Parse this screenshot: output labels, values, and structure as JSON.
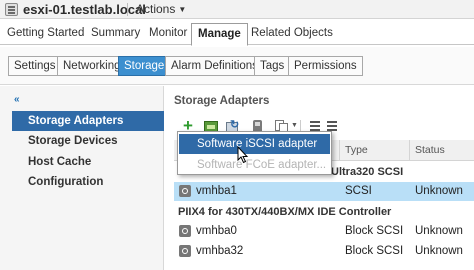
{
  "header": {
    "host_title": "esxi-01.testlab.local",
    "actions_label": "Actions",
    "host_icon": "host-server-icon",
    "actions_caret_icon": "chevron-down-icon"
  },
  "tabs": [
    {
      "label": "Getting Started"
    },
    {
      "label": "Summary"
    },
    {
      "label": "Monitor"
    },
    {
      "label": "Manage"
    },
    {
      "label": "Related Objects"
    }
  ],
  "subtabs": [
    {
      "label": "Settings"
    },
    {
      "label": "Networking"
    },
    {
      "label": "Storage"
    },
    {
      "label": "Alarm Definitions"
    },
    {
      "label": "Tags"
    },
    {
      "label": "Permissions"
    }
  ],
  "leftnav": {
    "collapse_glyph": "«",
    "items": [
      {
        "label": "Storage Adapters"
      },
      {
        "label": "Storage Devices"
      },
      {
        "label": "Host Cache Configuration"
      }
    ]
  },
  "main": {
    "section_title": "Storage Adapters",
    "toolbar_icons": [
      "add-icon",
      "adapter-chip-icon",
      "rescan-storage-icon",
      "device-icon",
      "copy-icon",
      "chevron-down-icon",
      "list-view-icon",
      "list-detail-icon"
    ],
    "columns": {
      "adapter": "",
      "type": "Type",
      "status": "Status"
    },
    "groups": [
      {
        "label_partial": "Ultra320 SCSI",
        "rows": [
          {
            "adapter": "vmhba1",
            "type": "SCSI",
            "status": "Unknown"
          }
        ]
      },
      {
        "label": "PIIX4 for 430TX/440BX/MX IDE Controller",
        "rows": [
          {
            "adapter": "vmhba0",
            "type": "Block SCSI",
            "status": "Unknown"
          },
          {
            "adapter": "vmhba32",
            "type": "Block SCSI",
            "status": "Unknown"
          }
        ]
      }
    ]
  },
  "add_menu": {
    "items": [
      {
        "label": "Software iSCSI adapter"
      },
      {
        "label": "Software FCoE adapter..."
      }
    ]
  },
  "colors": {
    "selected_nav": "#2f6aa7",
    "selected_row": "#b9dff7",
    "active_subtab": "#3c8fcf",
    "add_green": "#2e9b2e"
  }
}
